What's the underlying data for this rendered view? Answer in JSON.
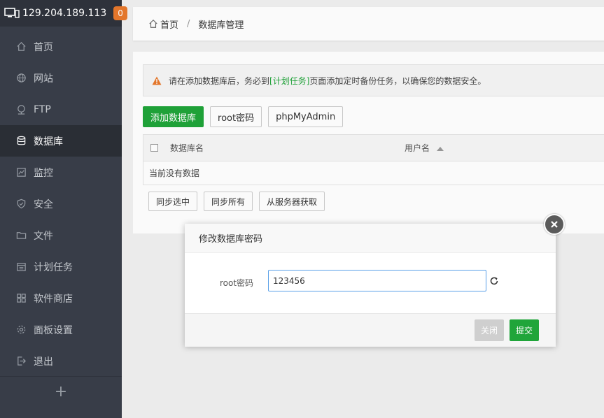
{
  "sidebar": {
    "server_ip": "129.204.189.113",
    "badge_count": "0",
    "items": [
      {
        "label": "首页",
        "icon": "home-icon"
      },
      {
        "label": "网站",
        "icon": "globe-icon"
      },
      {
        "label": "FTP",
        "icon": "ftp-icon"
      },
      {
        "label": "数据库",
        "icon": "database-icon"
      },
      {
        "label": "监控",
        "icon": "monitor-chart-icon"
      },
      {
        "label": "安全",
        "icon": "shield-icon"
      },
      {
        "label": "文件",
        "icon": "folder-icon"
      },
      {
        "label": "计划任务",
        "icon": "calendar-icon"
      },
      {
        "label": "软件商店",
        "icon": "grid-icon"
      },
      {
        "label": "面板设置",
        "icon": "gear-icon"
      },
      {
        "label": "退出",
        "icon": "logout-icon"
      }
    ],
    "active_index": 3,
    "add_symbol": "+"
  },
  "breadcrumb": {
    "home": "首页",
    "separator": "/",
    "current": "数据库管理"
  },
  "alert": {
    "prefix": "请在添加数据库后，务必到",
    "link": "[计划任务]",
    "suffix": "页面添加定时备份任务，以确保您的数据安全。"
  },
  "toolbar": {
    "add_db": "添加数据库",
    "root_pwd": "root密码",
    "phpmyadmin": "phpMyAdmin"
  },
  "table": {
    "col_name": "数据库名",
    "col_user": "用户名",
    "empty_text": "当前没有数据"
  },
  "sync": {
    "sync_selected": "同步选中",
    "sync_all": "同步所有",
    "fetch_server": "从服务器获取"
  },
  "dialog": {
    "title": "修改数据库密码",
    "label": "root密码",
    "value": "123456",
    "close_label": "关闭",
    "submit_label": "提交"
  },
  "colors": {
    "accent_green": "#20a53a",
    "sidebar_bg": "#3a3f4a",
    "badge": "#e8792c",
    "warning": "#e8792c"
  }
}
